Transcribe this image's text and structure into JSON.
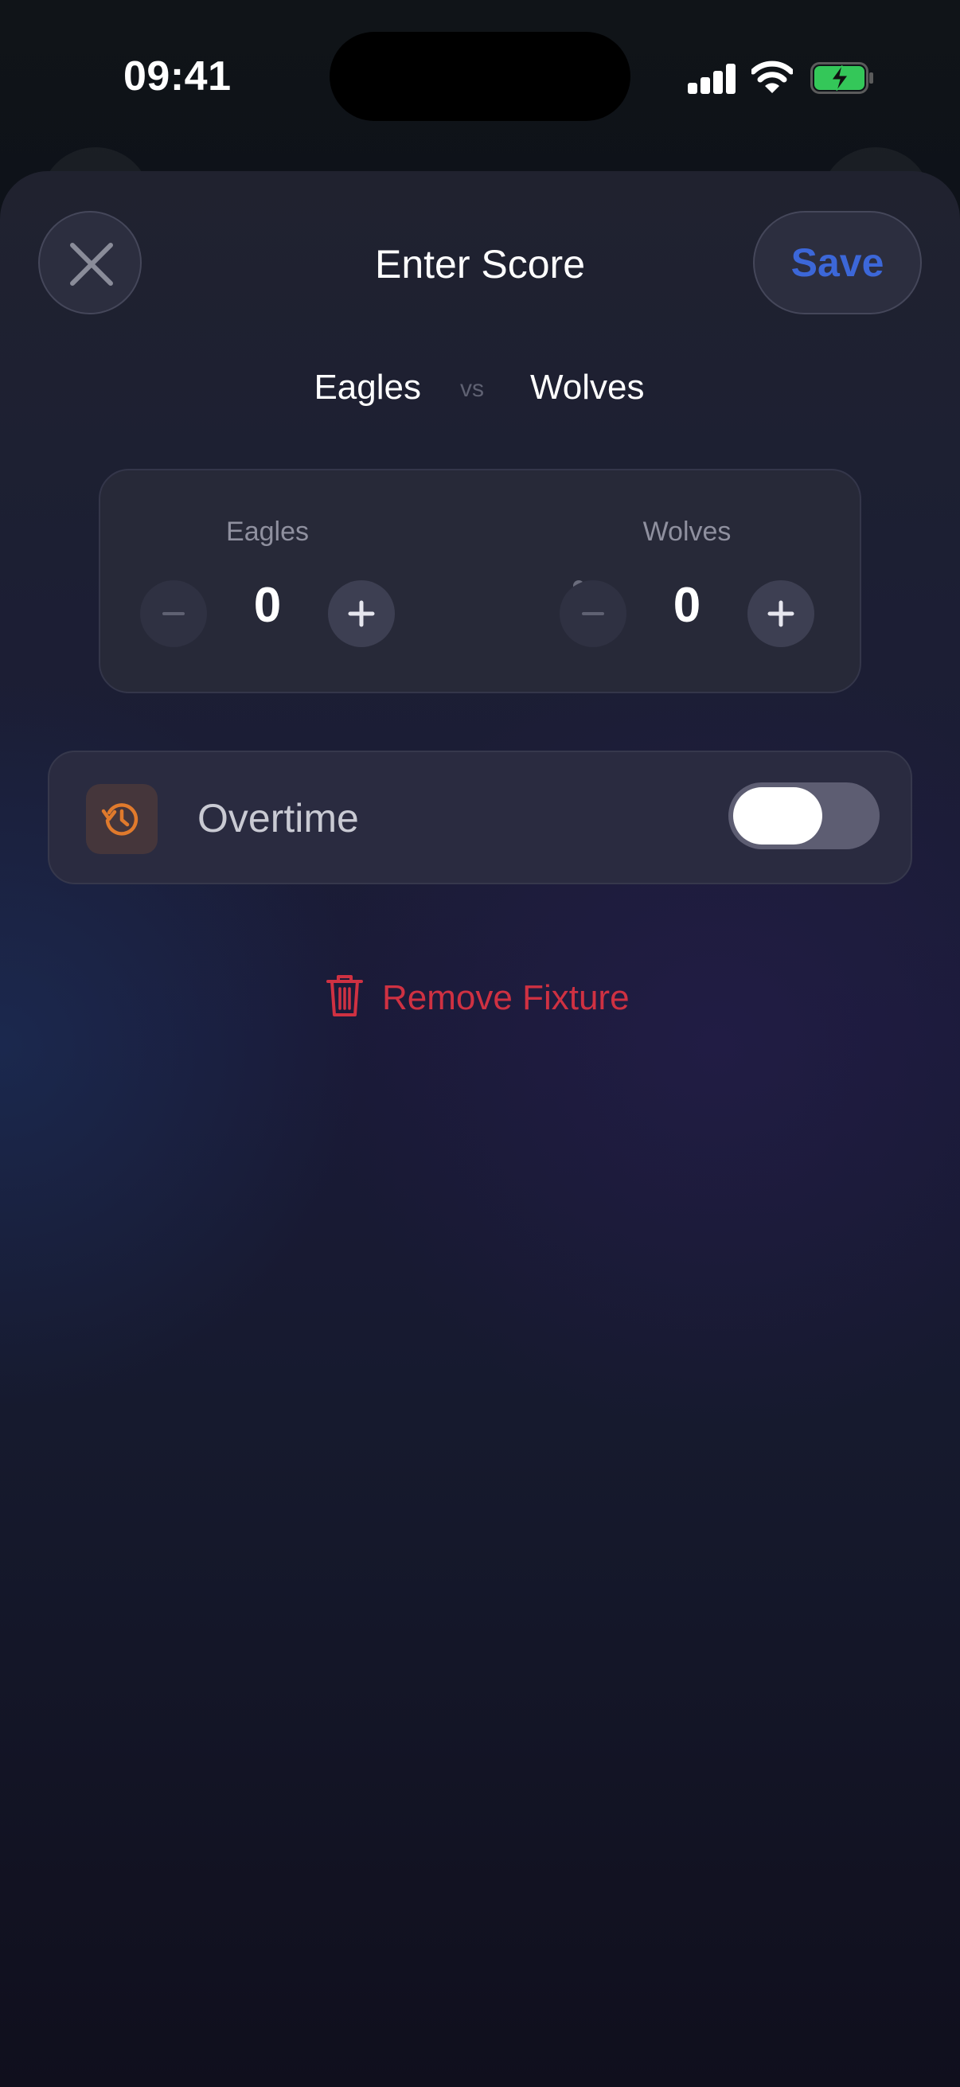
{
  "status_bar": {
    "time": "09:41"
  },
  "sheet": {
    "title": "Enter Score",
    "save_label": "Save",
    "close_icon": "close-icon"
  },
  "matchup": {
    "home_team": "Eagles",
    "vs_label": "vs",
    "away_team": "Wolves"
  },
  "score": {
    "home": {
      "name": "Eagles",
      "value": "0"
    },
    "away": {
      "name": "Wolves",
      "value": "0"
    },
    "separator_icon": "colon-icon"
  },
  "overtime": {
    "label": "Overtime",
    "icon": "history-clock-icon",
    "enabled": false
  },
  "remove": {
    "label": "Remove Fixture",
    "icon": "trash-icon"
  },
  "colors": {
    "accent": "#3c67d8",
    "destructive": "#cf3142",
    "overtime_icon": "#e07a2c",
    "battery_charging": "#34c759"
  }
}
